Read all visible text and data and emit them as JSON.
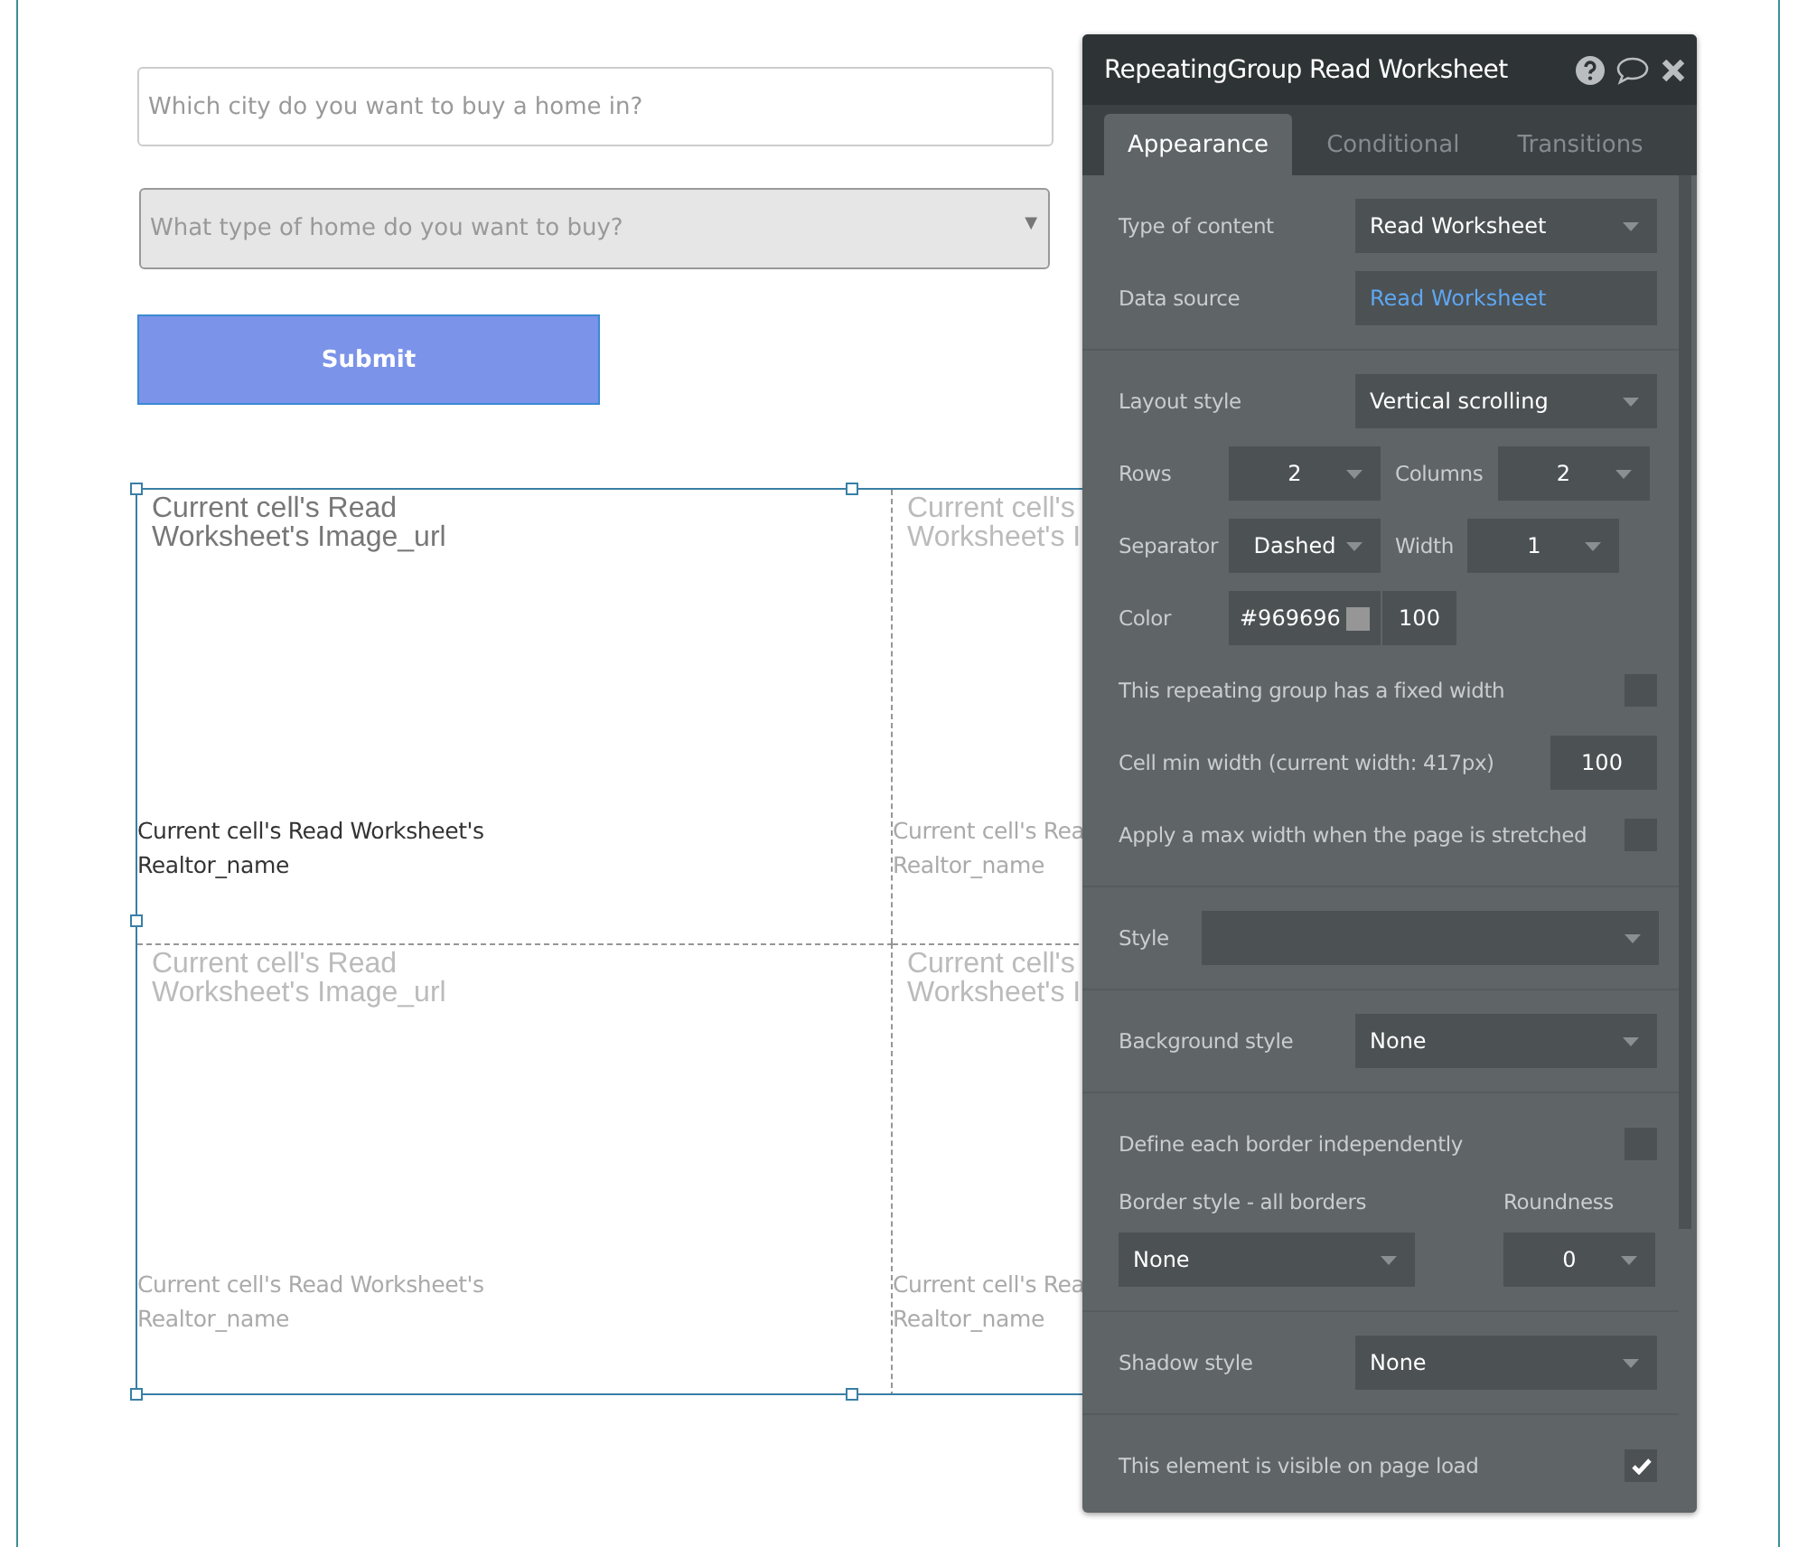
{
  "form": {
    "city_placeholder": "Which city do you want to buy a home in?",
    "type_placeholder": "What type of home do you want to buy?",
    "dropdown_arrow": "▼",
    "submit_label": "Submit"
  },
  "grid": {
    "selected": true,
    "cells": [
      {
        "image_lines": [
          "Current cell's Read",
          "Worksheet's Image_url"
        ],
        "realtor_lines": [
          "Current cell's Read Worksheet's",
          "Realtor_name"
        ],
        "dimmed": false
      },
      {
        "image_lines": [
          "Current cell's",
          "Worksheet's I"
        ],
        "realtor_lines": [
          "Current cell's Rea",
          "Realtor_name"
        ],
        "dimmed": true
      },
      {
        "image_lines": [
          "Current cell's Read",
          "Worksheet's Image_url"
        ],
        "realtor_lines": [
          "Current cell's Read Worksheet's",
          "Realtor_name"
        ],
        "dimmed": true
      },
      {
        "image_lines": [
          "Current cell's",
          "Worksheet's I"
        ],
        "realtor_lines": [
          "Current cell's Rea",
          "Realtor_name"
        ],
        "dimmed": true
      }
    ]
  },
  "panel": {
    "title": "RepeatingGroup Read Worksheet",
    "tabs": [
      {
        "label": "Appearance",
        "selected": true
      },
      {
        "label": "Conditional",
        "selected": false
      },
      {
        "label": "Transitions",
        "selected": false
      }
    ],
    "sections": [
      {
        "rows": [
          {
            "kind": "select",
            "label": "Type of content",
            "value": "Read Worksheet"
          },
          {
            "kind": "link",
            "label": "Data source",
            "value": "Read Worksheet"
          }
        ]
      },
      {
        "rows": [
          {
            "kind": "select",
            "label": "Layout style",
            "value": "Vertical scrolling"
          },
          {
            "kind": "pair",
            "items": [
              {
                "label": "Rows",
                "value": "2"
              },
              {
                "label": "Columns",
                "value": "2"
              }
            ]
          },
          {
            "kind": "pair",
            "items": [
              {
                "label": "Separator",
                "value": "Dashed"
              },
              {
                "label": "Width",
                "value": "1"
              }
            ]
          },
          {
            "kind": "color",
            "label": "Color",
            "hex": "#969696",
            "color": "#969696",
            "opacity": "100"
          },
          {
            "kind": "checkbox",
            "label": "This repeating group has a fixed width",
            "checked": false
          },
          {
            "kind": "number",
            "label": "Cell min width (current width: 417px)",
            "value": "100"
          },
          {
            "kind": "checkbox",
            "label": "Apply a max width when the page is stretched",
            "checked": false
          }
        ]
      },
      {
        "rows": [
          {
            "kind": "wide",
            "label": "Style"
          }
        ]
      },
      {
        "rows": [
          {
            "kind": "select",
            "label": "Background style",
            "value": "None"
          }
        ]
      },
      {
        "rows": [
          {
            "kind": "checkbox",
            "label": "Define each border independently",
            "checked": false
          },
          {
            "kind": "headings",
            "labels": [
              "Border style - all borders",
              "Roundness"
            ]
          },
          {
            "kind": "duo",
            "values": [
              "None",
              "0"
            ]
          }
        ]
      },
      {
        "rows": [
          {
            "kind": "select",
            "label": "Shadow style",
            "value": "None"
          }
        ]
      },
      {
        "rows": [
          {
            "kind": "checkbox",
            "label": "This element is visible on page load",
            "checked": true
          }
        ]
      }
    ]
  }
}
